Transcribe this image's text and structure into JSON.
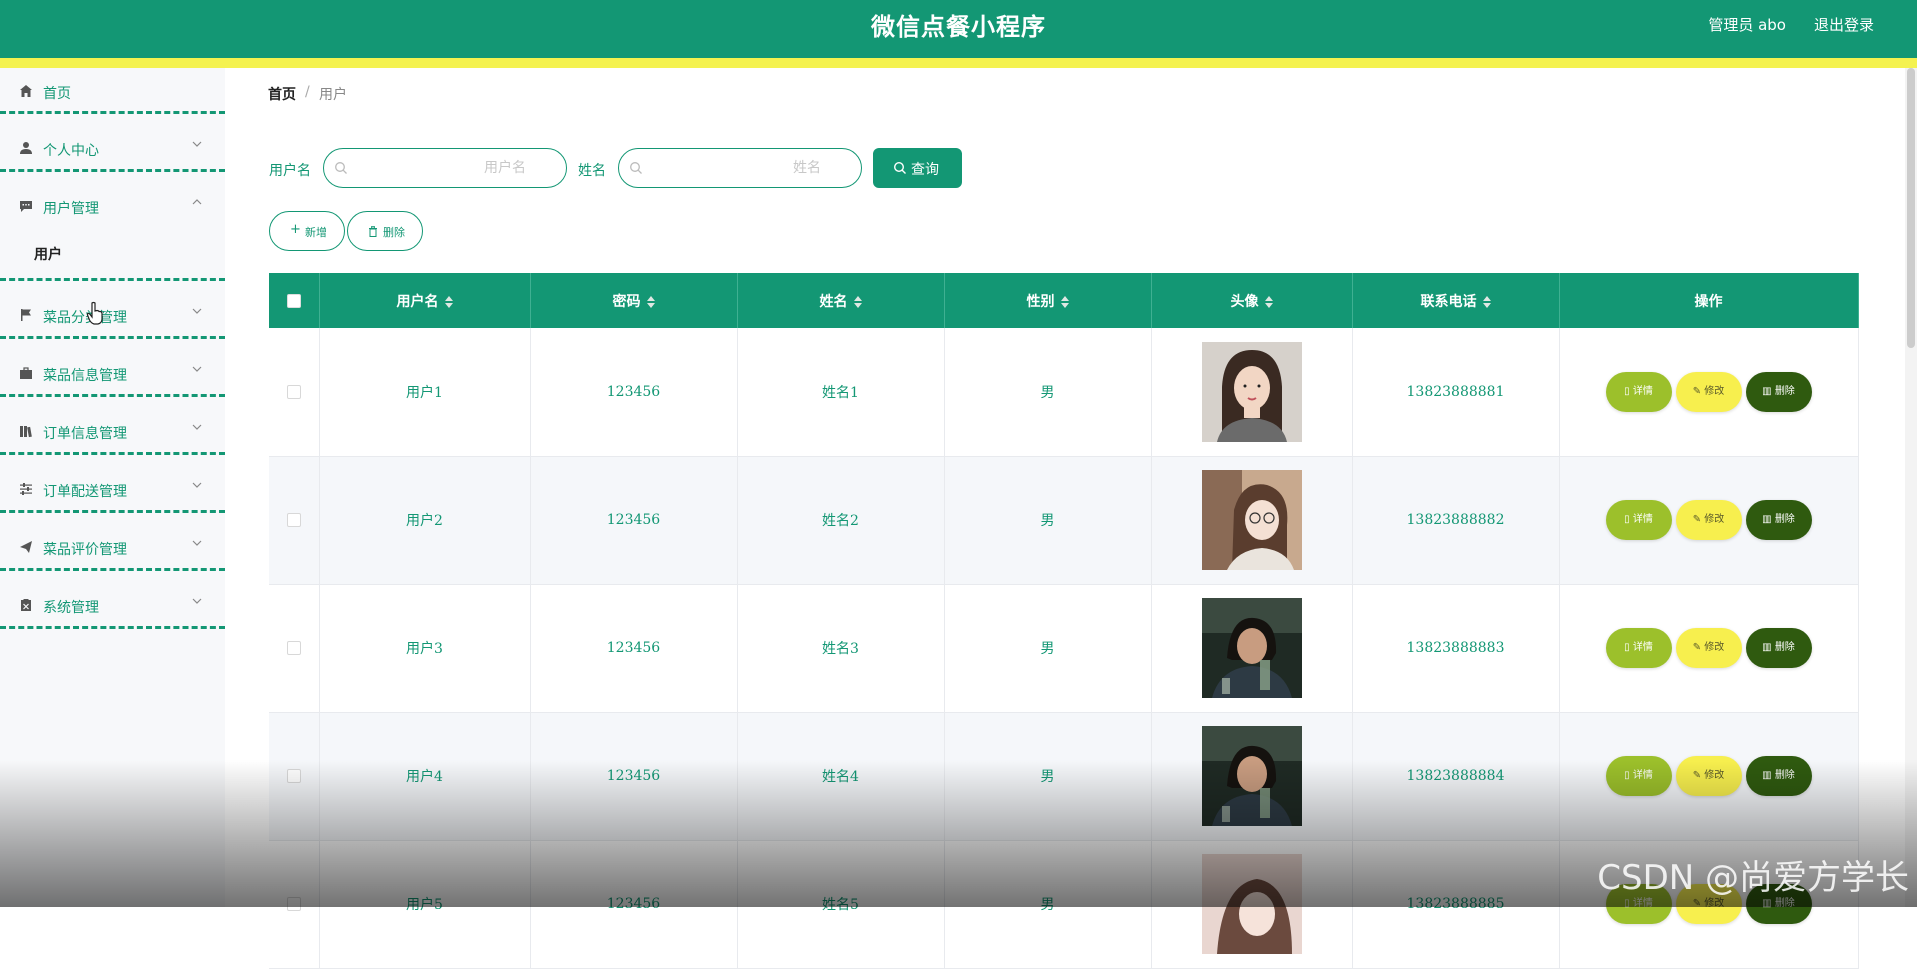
{
  "header": {
    "title": "微信点餐小程序",
    "admin": "管理员 abo",
    "logout": "退出登录"
  },
  "sidebar": {
    "items": [
      {
        "label": "首页",
        "icon": "home-icon"
      },
      {
        "label": "个人中心",
        "icon": "user-icon"
      },
      {
        "label": "用户管理",
        "icon": "chat-icon",
        "expanded": true,
        "children": [
          "用户"
        ]
      },
      {
        "label": "菜品分类管理",
        "icon": "flag-icon"
      },
      {
        "label": "菜品信息管理",
        "icon": "briefcase-icon"
      },
      {
        "label": "订单信息管理",
        "icon": "books-icon"
      },
      {
        "label": "订单配送管理",
        "icon": "sliders-icon"
      },
      {
        "label": "菜品评价管理",
        "icon": "paper-plane-icon"
      },
      {
        "label": "系统管理",
        "icon": "clipboard-icon"
      }
    ]
  },
  "breadcrumb": {
    "home": "首页",
    "separator": "/",
    "current": "用户"
  },
  "filters": {
    "username_label": "用户名",
    "username_placeholder": "用户名",
    "name_label": "姓名",
    "name_placeholder": "姓名",
    "query_button": "查询"
  },
  "actions": {
    "add": "新增",
    "delete": "删除"
  },
  "table": {
    "columns": [
      "用户名",
      "密码",
      "姓名",
      "性别",
      "头像",
      "联系电话",
      "操作"
    ],
    "row_actions": {
      "detail": "详情",
      "edit": "修改",
      "delete": "删除"
    },
    "rows": [
      {
        "username": "用户1",
        "password": "123456",
        "name": "姓名1",
        "gender": "男",
        "phone": "13823888881"
      },
      {
        "username": "用户2",
        "password": "123456",
        "name": "姓名2",
        "gender": "男",
        "phone": "13823888882"
      },
      {
        "username": "用户3",
        "password": "123456",
        "name": "姓名3",
        "gender": "男",
        "phone": "13823888883"
      },
      {
        "username": "用户4",
        "password": "123456",
        "name": "姓名4",
        "gender": "男",
        "phone": "13823888884"
      },
      {
        "username": "用户5",
        "password": "123456",
        "name": "姓名5",
        "gender": "男",
        "phone": "13823888885"
      }
    ]
  },
  "watermark": "CSDN @尚爱方学长",
  "colors": {
    "primary": "#139774",
    "strip": "#f4f24f",
    "detail": "#9cc02b",
    "edit": "#f7ef4e",
    "delete": "#2f5a0f"
  }
}
